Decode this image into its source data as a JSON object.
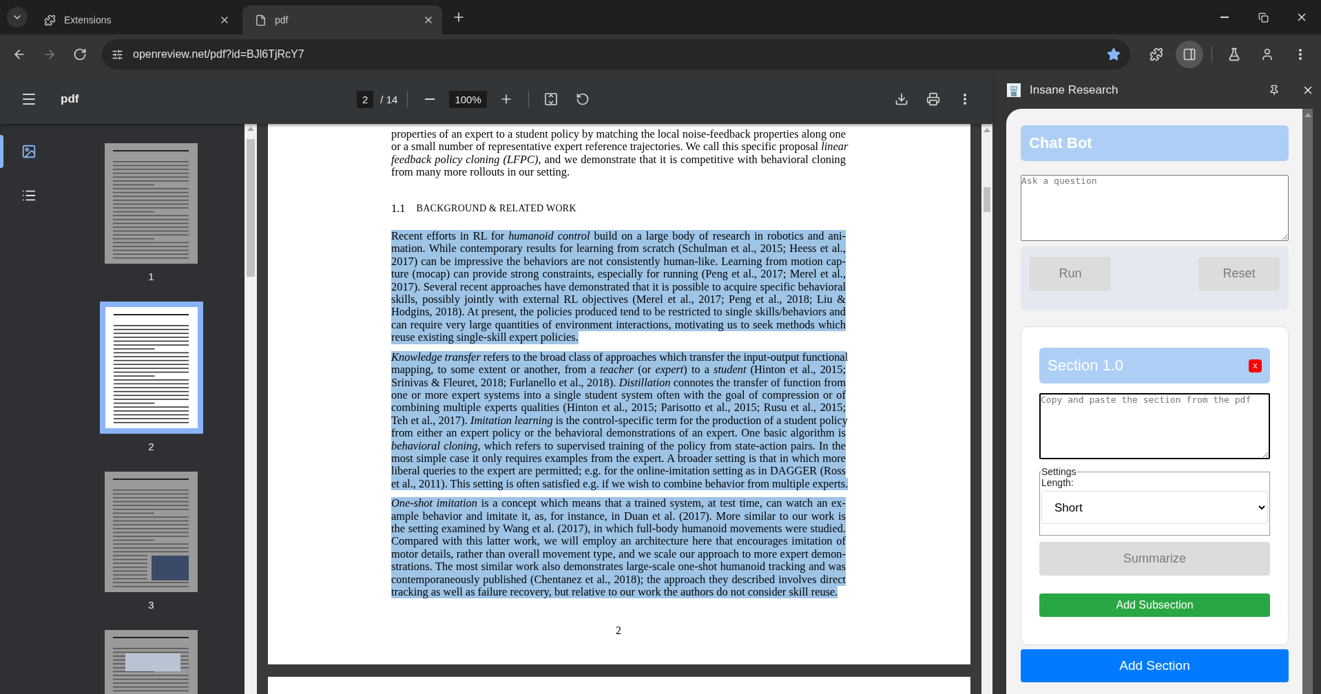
{
  "browser": {
    "tabs": [
      {
        "title": "Extensions",
        "kind": "extensions",
        "selected": false
      },
      {
        "title": "pdf",
        "kind": "document",
        "selected": true
      }
    ],
    "nav": [
      {
        "kind": "back",
        "disabled": false
      },
      {
        "kind": "forward",
        "disabled": true
      },
      {
        "kind": "reload",
        "disabled": false
      }
    ],
    "url": "openreview.net/pdf?id=BJl6TjRcY7",
    "bookmarked": true,
    "toolbar_icons": [
      {
        "kind": "extensions",
        "active": false
      },
      {
        "kind": "side-panel",
        "active": true
      },
      {
        "kind": "labs",
        "active": false
      },
      {
        "kind": "profile",
        "active": false
      },
      {
        "kind": "more",
        "active": false
      }
    ]
  },
  "pdf_viewer": {
    "title": "pdf",
    "page": "2",
    "page_count": "/ 14",
    "zoom": "100%",
    "sidebar_tabs": [
      {
        "kind": "thumbnails",
        "selected": true
      },
      {
        "kind": "outline",
        "selected": false
      }
    ],
    "thumbnails": [
      {
        "label": "1",
        "selected": false
      },
      {
        "label": "2",
        "selected": true
      },
      {
        "label": "3",
        "selected": false
      },
      {
        "selected": false
      }
    ],
    "document": {
      "blocks": [
        {
          "kind": "paragraph",
          "selected": false,
          "lines": [
            "properties of an expert to a student policy by matching the local noise-feedback properties along one",
            "or a small number of representative expert reference trajectories. We call this specific proposal *linear*",
            "*feedback policy cloning (LFPC)*, and we demonstrate that it is competitive with behavioral cloning",
            "from many more rollouts in our setting."
          ]
        },
        {
          "kind": "heading",
          "number": "1.1",
          "title": "BACKGROUND & RELATED WORK"
        },
        {
          "kind": "paragraph",
          "selected": true,
          "lines": [
            "Recent efforts in RL for *humanoid control* build on a large body of research in robotics and ani-",
            "mation. While contemporary results for learning from scratch (Schulman et al., 2015; Heess et al.,",
            "2017) can be impressive the behaviors are not consistently human-like. Learning from motion cap-",
            "ture (mocap) can provide strong constraints, especially for running (Peng et al., 2017; Merel et al.,",
            "2017). Several recent approaches have demonstrated that it is possible to acquire specific behavioral",
            "skills, possibly jointly with external RL objectives (Merel et al., 2017; Peng et al., 2018; Liu &",
            "Hodgins, 2018). At present, the policies produced tend to be restricted to single skills/behaviors and",
            "can require very large quantities of environment interactions, motivating us to seek methods which",
            "reuse existing single-skill expert policies."
          ]
        },
        {
          "kind": "paragraph",
          "selected": true,
          "lines": [
            "*Knowledge transfer* refers to the broad class of approaches which transfer the input-output functional",
            "mapping, to some extent or another, from a *teacher* (or *expert*) to a *student* (Hinton et al., 2015;",
            "Srinivas & Fleuret, 2018; Furlanello et al., 2018). *Distillation* connotes the transfer of function from",
            "one or more expert systems into a single student system often with the goal of compression or of",
            "combining multiple experts qualities (Hinton et al., 2015; Parisotto et al., 2015; Rusu et al., 2015;",
            "Teh et al., 2017). *Imitation learning* is the control-specific term for the production of a student policy",
            "from either an expert policy or the behavioral demonstrations of an expert. One basic algorithm is",
            "*behavioral cloning*, which refers to supervised training of the policy from state-action pairs. In the",
            "most simple case it only requires examples from the expert. A broader setting is that in which more",
            "liberal queries to the expert are permitted; e.g. for the online-imitation setting as in DAGGER (Ross",
            "et al., 2011). This setting is often satisfied e.g. if we wish to combine behavior from multiple experts."
          ]
        },
        {
          "kind": "paragraph",
          "selected": true,
          "lines": [
            "*One-shot imitation* is a concept which means that a trained system, at test time, can watch an ex-",
            "ample behavior and imitate it, as, for instance, in Duan et al. (2017). More similar to our work is",
            "the setting examined by Wang et al. (2017), in which full-body humanoid movements were studied.",
            "Compared with this latter work, we will employ an architecture here that encourages imitation of",
            "motor details, rather than overall movement type, and we scale our approach to more expert demon-",
            "strations. The most similar work also demonstrates large-scale one-shot humanoid tracking and was",
            "contemporaneously published (Chentanez et al., 2018); the approach they described involves direct",
            "tracking as well as failure recovery, but relative to our work the authors do not consider skill reuse."
          ]
        }
      ],
      "page_number": "2"
    }
  },
  "side_panel": {
    "title": "Insane Research",
    "chat_bot": {
      "title": "Chat Bot",
      "placeholder": "Ask a question",
      "buttons": [
        {
          "label": "Run",
          "disabled": true
        },
        {
          "label": "Reset",
          "disabled": true
        }
      ]
    },
    "sections": [
      {
        "title": "Section 1.0",
        "remove": "x",
        "placeholder": "Copy and paste the section from the pdf",
        "settings_legend": "Settings",
        "length_label": "Length:",
        "length_value": "Short",
        "summarize": {
          "label": "Summarize",
          "disabled": true
        },
        "add_subsection": "Add Subsection"
      }
    ],
    "add_section": "Add Section"
  }
}
